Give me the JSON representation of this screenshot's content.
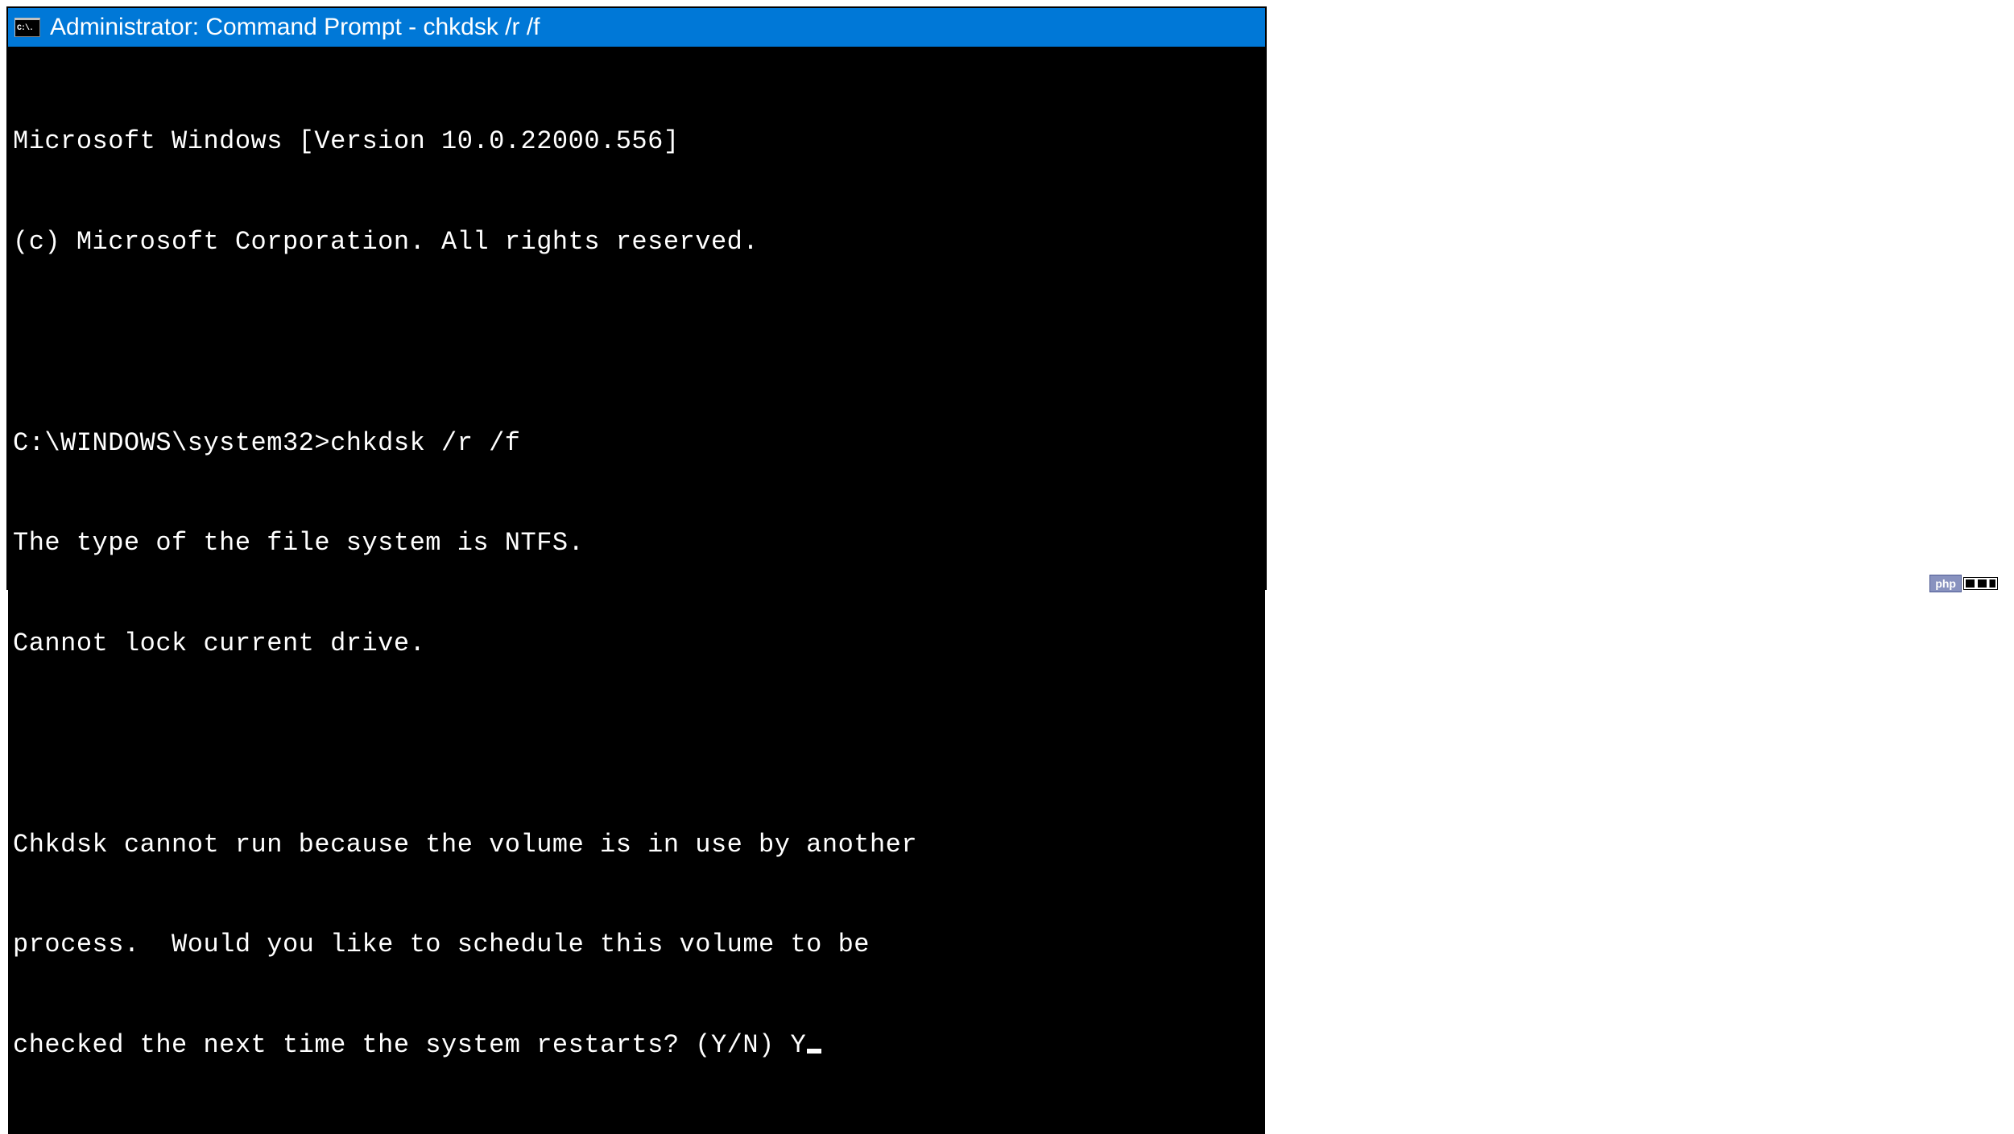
{
  "window": {
    "icon_glyph": "C:\\.",
    "title": "Administrator: Command Prompt - chkdsk  /r /f"
  },
  "terminal": {
    "lines": [
      "Microsoft Windows [Version 10.0.22000.556]",
      "(c) Microsoft Corporation. All rights reserved.",
      "",
      "C:\\WINDOWS\\system32>chkdsk /r /f",
      "The type of the file system is NTFS.",
      "Cannot lock current drive.",
      "",
      "Chkdsk cannot run because the volume is in use by another",
      "process.  Would you like to schedule this volume to be"
    ],
    "prompt_line": "checked the next time the system restarts? (Y/N) ",
    "user_input": "Y"
  },
  "watermark": {
    "text": "php"
  }
}
